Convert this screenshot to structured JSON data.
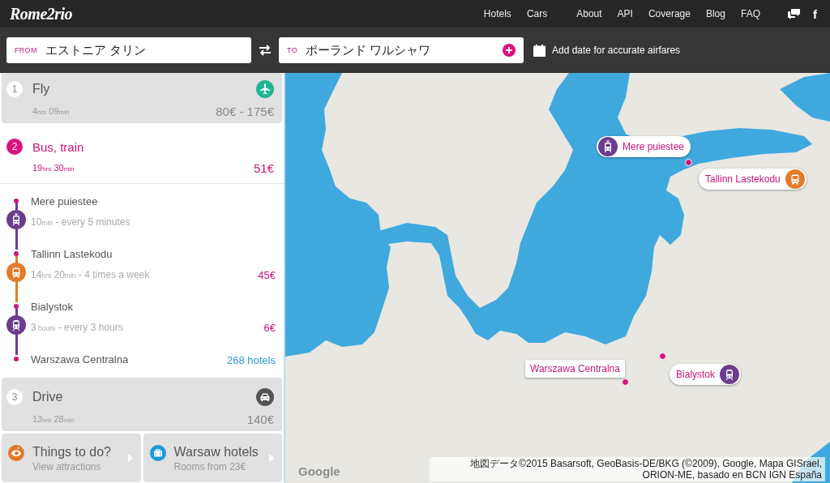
{
  "header": {
    "logo": "Rome2rio",
    "nav_primary": [
      "Hotels",
      "Cars"
    ],
    "nav_secondary": [
      "About",
      "API",
      "Coverage",
      "Blog",
      "FAQ"
    ],
    "social": [
      {
        "kind": "chat"
      },
      {
        "kind": "facebook",
        "label": "f"
      }
    ]
  },
  "search": {
    "from": {
      "label": "FROM",
      "value": "エストニア タリン"
    },
    "to": {
      "label": "TO",
      "value": "ポーランド ワルシャワ"
    },
    "date_prompt": "Add date for accurate airfares"
  },
  "routes": [
    {
      "number": "1",
      "title": "Fly",
      "kind": "fly",
      "selected": false,
      "duration": [
        {
          "text": "4",
          "kind": "number"
        },
        {
          "text": "hrs",
          "kind": "unit"
        },
        {
          "text": " 09",
          "kind": "number"
        },
        {
          "text": "min",
          "kind": "unit"
        }
      ],
      "price": "80€ - 175€"
    },
    {
      "number": "2",
      "title": "Bus, train",
      "kind": "transit",
      "selected": true,
      "duration": [
        {
          "text": "19",
          "kind": "number"
        },
        {
          "text": "hrs",
          "kind": "unit"
        },
        {
          "text": " 30",
          "kind": "number"
        },
        {
          "text": "min",
          "kind": "unit"
        }
      ],
      "price": "51€",
      "legs": [
        {
          "stop": "Mere puiestee",
          "kind": "tram",
          "color": "#6c3d8e",
          "schedule": [
            {
              "text": "10",
              "kind": "number"
            },
            {
              "text": "min",
              "kind": "unit"
            },
            {
              "text": " - every 5 minutes",
              "kind": "text"
            }
          ]
        },
        {
          "stop": "Tallinn Lastekodu",
          "kind": "bus",
          "color": "#e47b2a",
          "schedule": [
            {
              "text": "14",
              "kind": "number"
            },
            {
              "text": "hrs",
              "kind": "unit"
            },
            {
              "text": " 20",
              "kind": "number"
            },
            {
              "text": "min",
              "kind": "unit"
            },
            {
              "text": " - 4 times a week",
              "kind": "text"
            }
          ],
          "price": "45€"
        },
        {
          "stop": "Bialystok",
          "kind": "train",
          "color": "#6c3d8e",
          "schedule": [
            {
              "text": "3",
              "kind": "number"
            },
            {
              "text": " hours",
              "kind": "unit"
            },
            {
              "text": " - every 3 hours",
              "kind": "text"
            }
          ],
          "price": "6€"
        }
      ],
      "destination": {
        "name": "Warszawa Centralna",
        "hotels": "268 hotels"
      }
    },
    {
      "number": "3",
      "title": "Drive",
      "kind": "drive",
      "selected": false,
      "duration": [
        {
          "text": "13",
          "kind": "number"
        },
        {
          "text": "hrs",
          "kind": "unit"
        },
        {
          "text": " 28",
          "kind": "number"
        },
        {
          "text": "min",
          "kind": "unit"
        }
      ],
      "price": "140€"
    }
  ],
  "extras": [
    {
      "kind": "attractions",
      "title": "Things to do?",
      "subtitle": "View attractions"
    },
    {
      "kind": "hotels",
      "title": "Warsaw hotels",
      "subtitle": "Rooms from 23€"
    }
  ],
  "map": {
    "markers": [
      {
        "label": "Mere puiestee",
        "kind": "tram",
        "color": "#6c3d8e"
      },
      {
        "label": "Tallinn Lastekodu",
        "kind": "bus",
        "color": "#e47b2a"
      },
      {
        "label": "Warszawa Centralna",
        "kind": "stop"
      },
      {
        "label": "Bialystok",
        "kind": "train",
        "color": "#6c3d8e"
      }
    ],
    "logo": "Google",
    "attribution": "地図データ©2015 Basarsoft, GeoBasis-DE/BKG (©2009), Google, Mapa GISrael, ORION-ME, basado en BCN IGN España"
  }
}
